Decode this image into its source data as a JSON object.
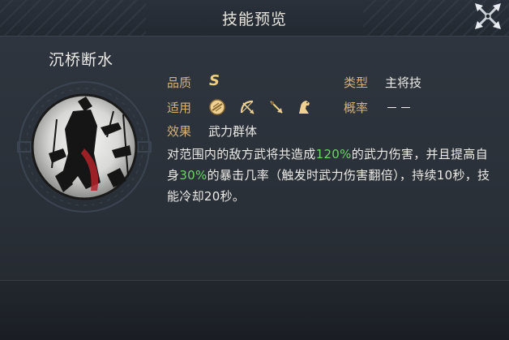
{
  "window": {
    "title": "技能预览"
  },
  "skill": {
    "name": "沉桥断水",
    "quality_label": "品质",
    "quality_value": "S",
    "type_label": "类型",
    "type_value": "主将技",
    "applicable_label": "适用",
    "applicable_icons": [
      "shield-icon",
      "bow-icon",
      "spear-icon",
      "horse-icon"
    ],
    "rate_label": "概率",
    "rate_value": "－－",
    "effect_label": "效果",
    "effect_value": "武力群体",
    "description": {
      "p1": "对范围内的敌方武将共造成",
      "v1": "120%",
      "p2": "的武力伤害，并且提高自身",
      "v2": "30%",
      "p3": "的暴击几率（触发时武力伤害翻倍），持续10秒，技能冷却20秒。"
    }
  },
  "colors": {
    "label": "#d7b27a",
    "text": "#ecebe6",
    "highlight": "#6fd36a",
    "grade": "#efcf7e"
  }
}
